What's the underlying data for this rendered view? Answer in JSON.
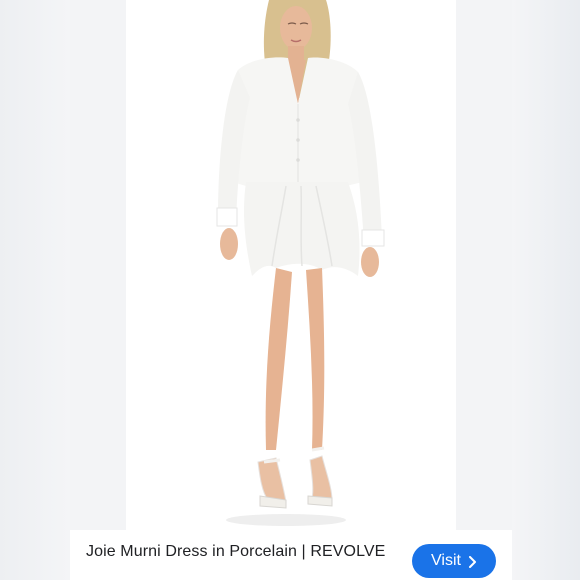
{
  "product": {
    "caption": "Joie Murni Dress in Porcelain | REVOLVE",
    "visit_label": "Visit",
    "image_alt": "Model wearing white long-sleeve shirt dress with strappy heels"
  },
  "colors": {
    "visit_button": "#1a73e8",
    "caption_text": "#202124",
    "dress": "#f6f6f4"
  },
  "icons": {
    "visit_chevron": "chevron-right-icon"
  }
}
